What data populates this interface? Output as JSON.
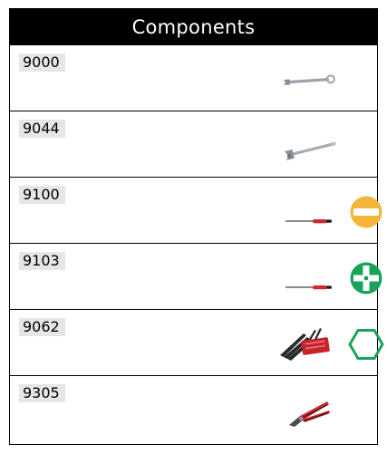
{
  "header": {
    "title": "Components"
  },
  "components": [
    {
      "code": "9000",
      "tool_icon": "combination-wrench-icon",
      "symbol_icon": ""
    },
    {
      "code": "9044",
      "tool_icon": "adjustable-wrench-icon",
      "symbol_icon": ""
    },
    {
      "code": "9100",
      "tool_icon": "screwdriver-icon",
      "symbol_icon": "slotted-symbol-icon",
      "symbol_color": "#f4b63a"
    },
    {
      "code": "9103",
      "tool_icon": "screwdriver-icon",
      "symbol_icon": "phillips-symbol-icon",
      "symbol_color": "#1aa35a"
    },
    {
      "code": "9062",
      "tool_icon": "hex-key-set-icon",
      "symbol_icon": "hexagon-symbol-icon",
      "symbol_color": "#1aa35a"
    },
    {
      "code": "9305",
      "tool_icon": "pliers-icon",
      "symbol_icon": ""
    }
  ]
}
